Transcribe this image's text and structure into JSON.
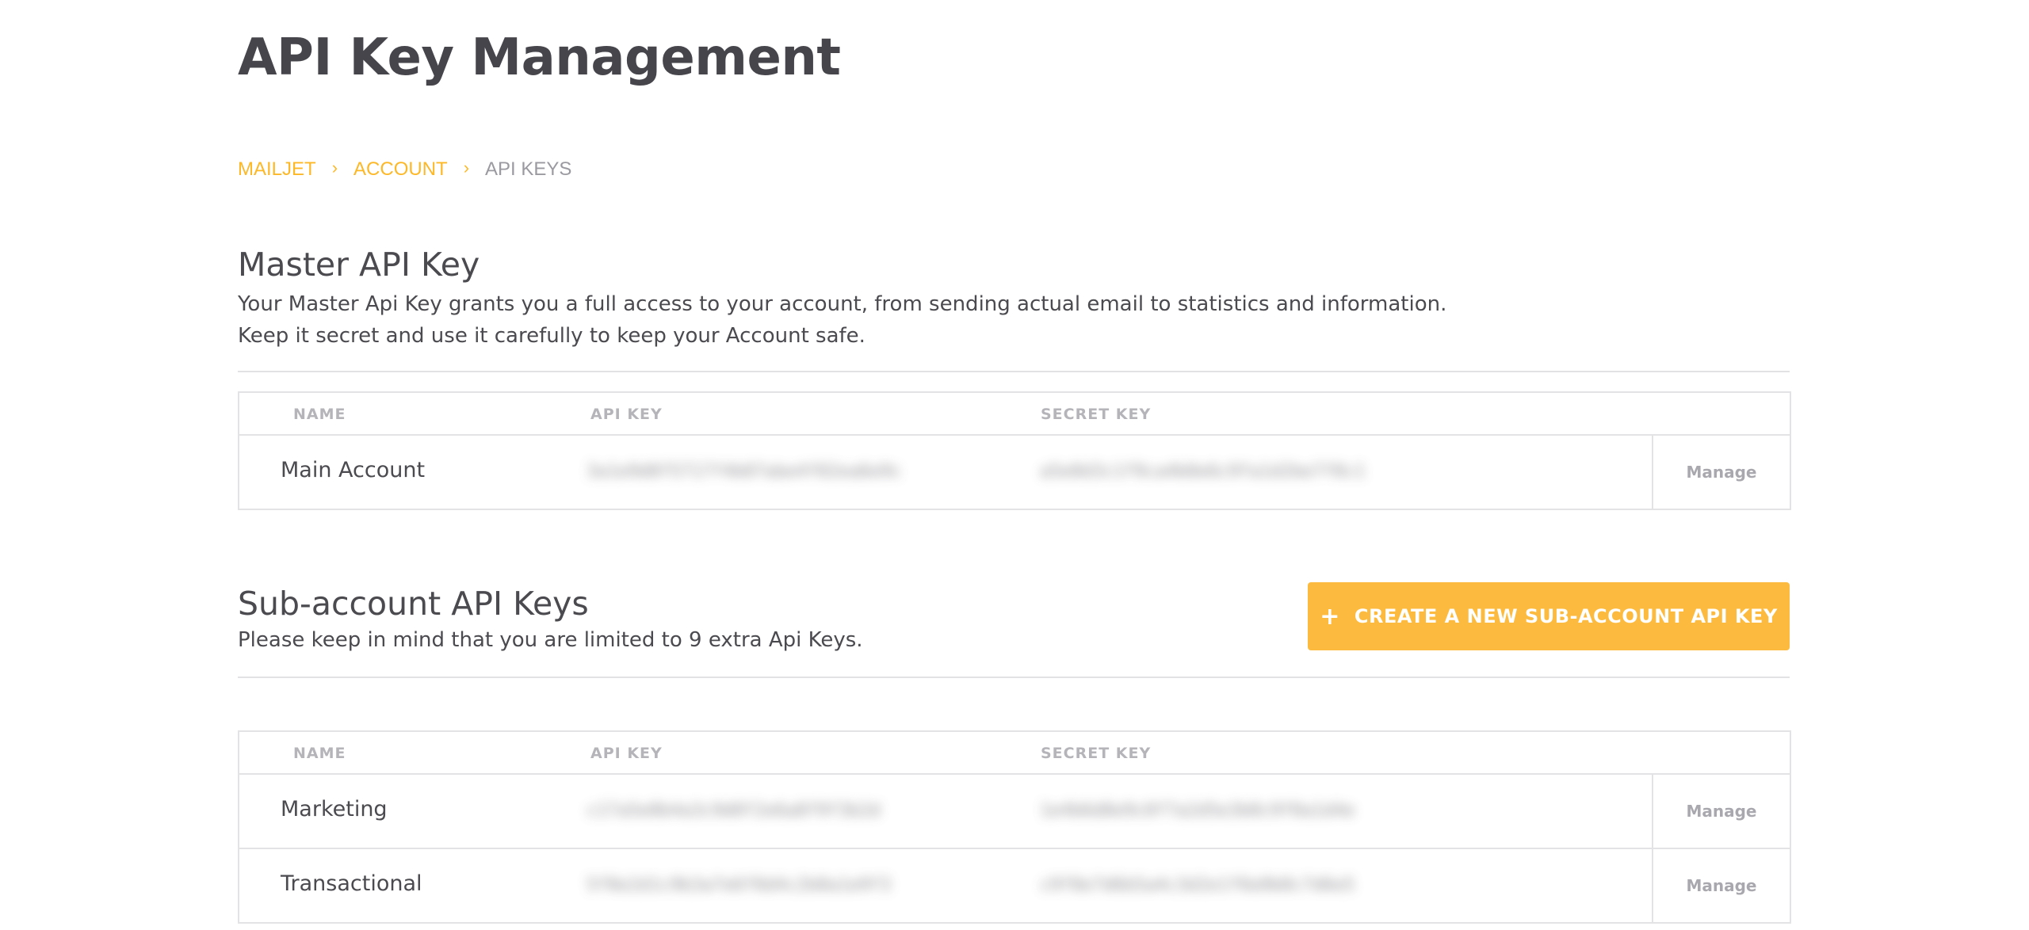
{
  "page": {
    "title": "API Key Management"
  },
  "breadcrumb": {
    "items": [
      {
        "label": "MAILJET"
      },
      {
        "label": "ACCOUNT"
      },
      {
        "label": "API KEYS"
      }
    ],
    "separator": "›"
  },
  "master": {
    "title": "Master API Key",
    "description_lines": [
      "Your Master Api Key grants you a full access to your account, from sending actual email to statistics and information.",
      "Keep it secret and use it carefully to keep your Account safe."
    ],
    "table": {
      "columns": [
        "NAME",
        "API KEY",
        "SECRET KEY"
      ],
      "rows": [
        {
          "name": "Main Account",
          "api_key": "3a1e9d8f5717f4b07abe4f02ea6e9c",
          "secret_key": "a5e8d3c1f9ca4b0e6c9fa1d2be7f8c1",
          "manage_label": "Manage"
        }
      ]
    }
  },
  "subaccounts": {
    "title": "Sub-account API Keys",
    "description": "Please keep in mind that you are limited to 9 extra Api Keys.",
    "create_button_label": "CREATE A NEW SUB-ACCOUNT API KEY",
    "table": {
      "columns": [
        "NAME",
        "API KEY",
        "SECRET KEY"
      ],
      "rows": [
        {
          "name": "Marketing",
          "api_key": "c17a5e8b4a3c9d0f2e6a8f9f3b2d",
          "secret_key": "1e4b6d8e9c0f7a2d5e3b8c9f0a1d4e",
          "manage_label": "Manage"
        },
        {
          "name": "Transactional",
          "api_key": "5f8e2d1c9b3a7e6f0d4c2b8a1e9f3",
          "secret_key": "c9f8e7d6b5a4c3d2e1f0a9b8c7d6e5",
          "manage_label": "Manage"
        }
      ]
    }
  },
  "colors": {
    "accent": "#fdb828",
    "button": "#fcbb3f",
    "text": "#4a4a4f",
    "muted": "#b4b4b9",
    "border": "#e3e3e6"
  }
}
